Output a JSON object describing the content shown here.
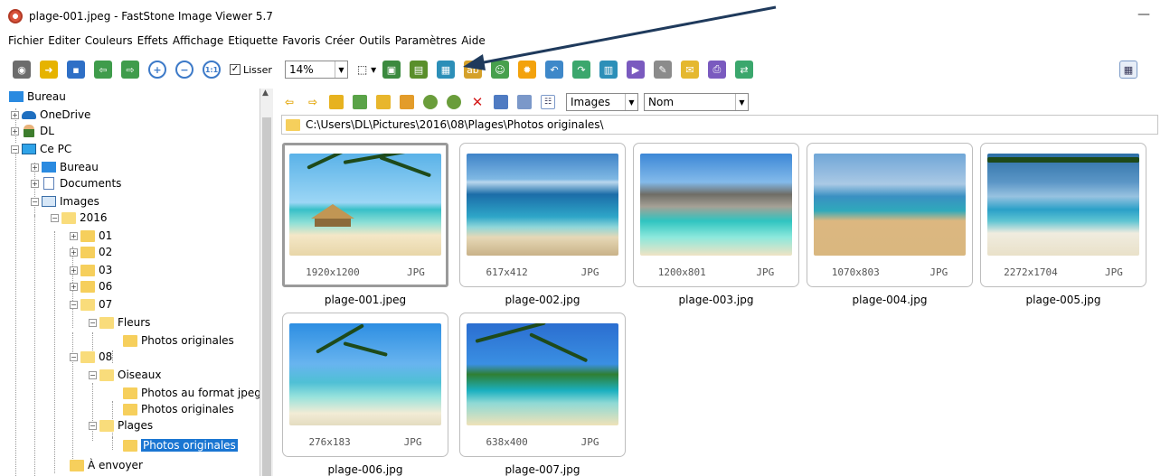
{
  "window": {
    "title": "plage-001.jpeg  -  FastStone Image Viewer 5.7",
    "minimize_glyph": "—"
  },
  "menu": [
    "Fichier",
    "Editer",
    "Couleurs",
    "Effets",
    "Affichage",
    "Etiquette",
    "Favoris",
    "Créer",
    "Outils",
    "Paramètres",
    "Aide"
  ],
  "toolbar": {
    "lisser_label": "Lisser",
    "lisser_checked": true,
    "zoom_value": "14%",
    "icons": [
      "camera-icon",
      "open-folder-icon",
      "save-icon",
      "previous-icon",
      "next-icon",
      "zoom-in-icon",
      "zoom-out-icon",
      "actual-size-icon",
      "select-region-icon",
      "fit-icon",
      "copy-to-icon",
      "move-to-icon",
      "rename-icon",
      "contact-icon",
      "effects-icon",
      "rotate-left-icon",
      "rotate-right-icon",
      "compare-icon",
      "slideshow-icon",
      "draw-icon",
      "email-icon",
      "print-icon",
      "convert-icon",
      "layout-icon"
    ]
  },
  "tree": {
    "items": [
      {
        "label": "Bureau"
      },
      {
        "label": "OneDrive"
      },
      {
        "label": "DL"
      },
      {
        "label": "Ce PC"
      },
      {
        "label": "Bureau"
      },
      {
        "label": "Documents"
      },
      {
        "label": "Images"
      },
      {
        "label": "2016"
      },
      {
        "label": "01"
      },
      {
        "label": "02"
      },
      {
        "label": "03"
      },
      {
        "label": "06"
      },
      {
        "label": "07"
      },
      {
        "label": "Fleurs"
      },
      {
        "label": "Photos originales"
      },
      {
        "label": "08"
      },
      {
        "label": "Oiseaux"
      },
      {
        "label": "Photos au format jpeg"
      },
      {
        "label": "Photos originales"
      },
      {
        "label": "Plages"
      },
      {
        "label": "Photos originales",
        "selected": true
      },
      {
        "label": "À envoyer"
      }
    ]
  },
  "browser": {
    "filter_value": "Images",
    "sort_value": "Nom",
    "path": "C:\\Users\\DL\\Pictures\\2016\\08\\Plages\\Photos originales\\"
  },
  "thumbnails": [
    {
      "name": "plage-001.jpeg",
      "dims": "1920x1200",
      "type": "JPG",
      "selected": true
    },
    {
      "name": "plage-002.jpg",
      "dims": "617x412",
      "type": "JPG"
    },
    {
      "name": "plage-003.jpg",
      "dims": "1200x801",
      "type": "JPG"
    },
    {
      "name": "plage-004.jpg",
      "dims": "1070x803",
      "type": "JPG"
    },
    {
      "name": "plage-005.jpg",
      "dims": "2272x1704",
      "type": "JPG"
    },
    {
      "name": "plage-006.jpg",
      "dims": "276x183",
      "type": "JPG"
    },
    {
      "name": "plage-007.jpg",
      "dims": "638x400",
      "type": "JPG"
    }
  ],
  "colors": {
    "selection": "#1a76d2",
    "annotation_arrow": "#1f3a5c"
  }
}
